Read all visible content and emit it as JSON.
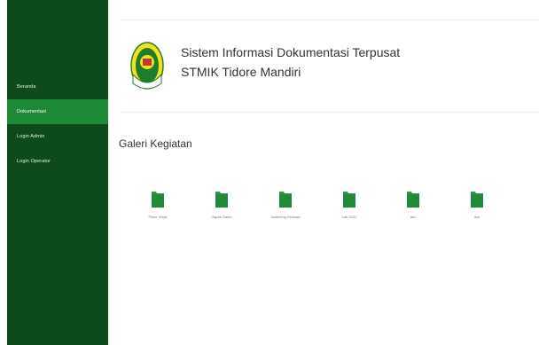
{
  "sidebar": {
    "items": [
      {
        "label": "Beranda",
        "active": false
      },
      {
        "label": "Dokumentasi",
        "active": true
      },
      {
        "label": "Login Admin",
        "active": false
      },
      {
        "label": "Login Operator",
        "active": false
      }
    ]
  },
  "header": {
    "title_line1": "Sistem Informasi Dokumentasi Terpusat",
    "title_line2": "STMIK Tidore Mandiri"
  },
  "gallery": {
    "title": "Galeri Kegiatan",
    "folders": [
      {
        "label": "Ploce Vidya"
      },
      {
        "label": "Ospek Galen"
      },
      {
        "label": "Gathering Kemase"
      },
      {
        "label": "Lab 2022"
      },
      {
        "label": "abc"
      },
      {
        "label": "ikm"
      }
    ]
  },
  "colors": {
    "sidebar_bg": "#0d4a1c",
    "active_item": "#1e8a38",
    "folder": "#2f9a45"
  },
  "icons": {
    "logo": "stmik-logo",
    "folder": "folder-icon"
  }
}
